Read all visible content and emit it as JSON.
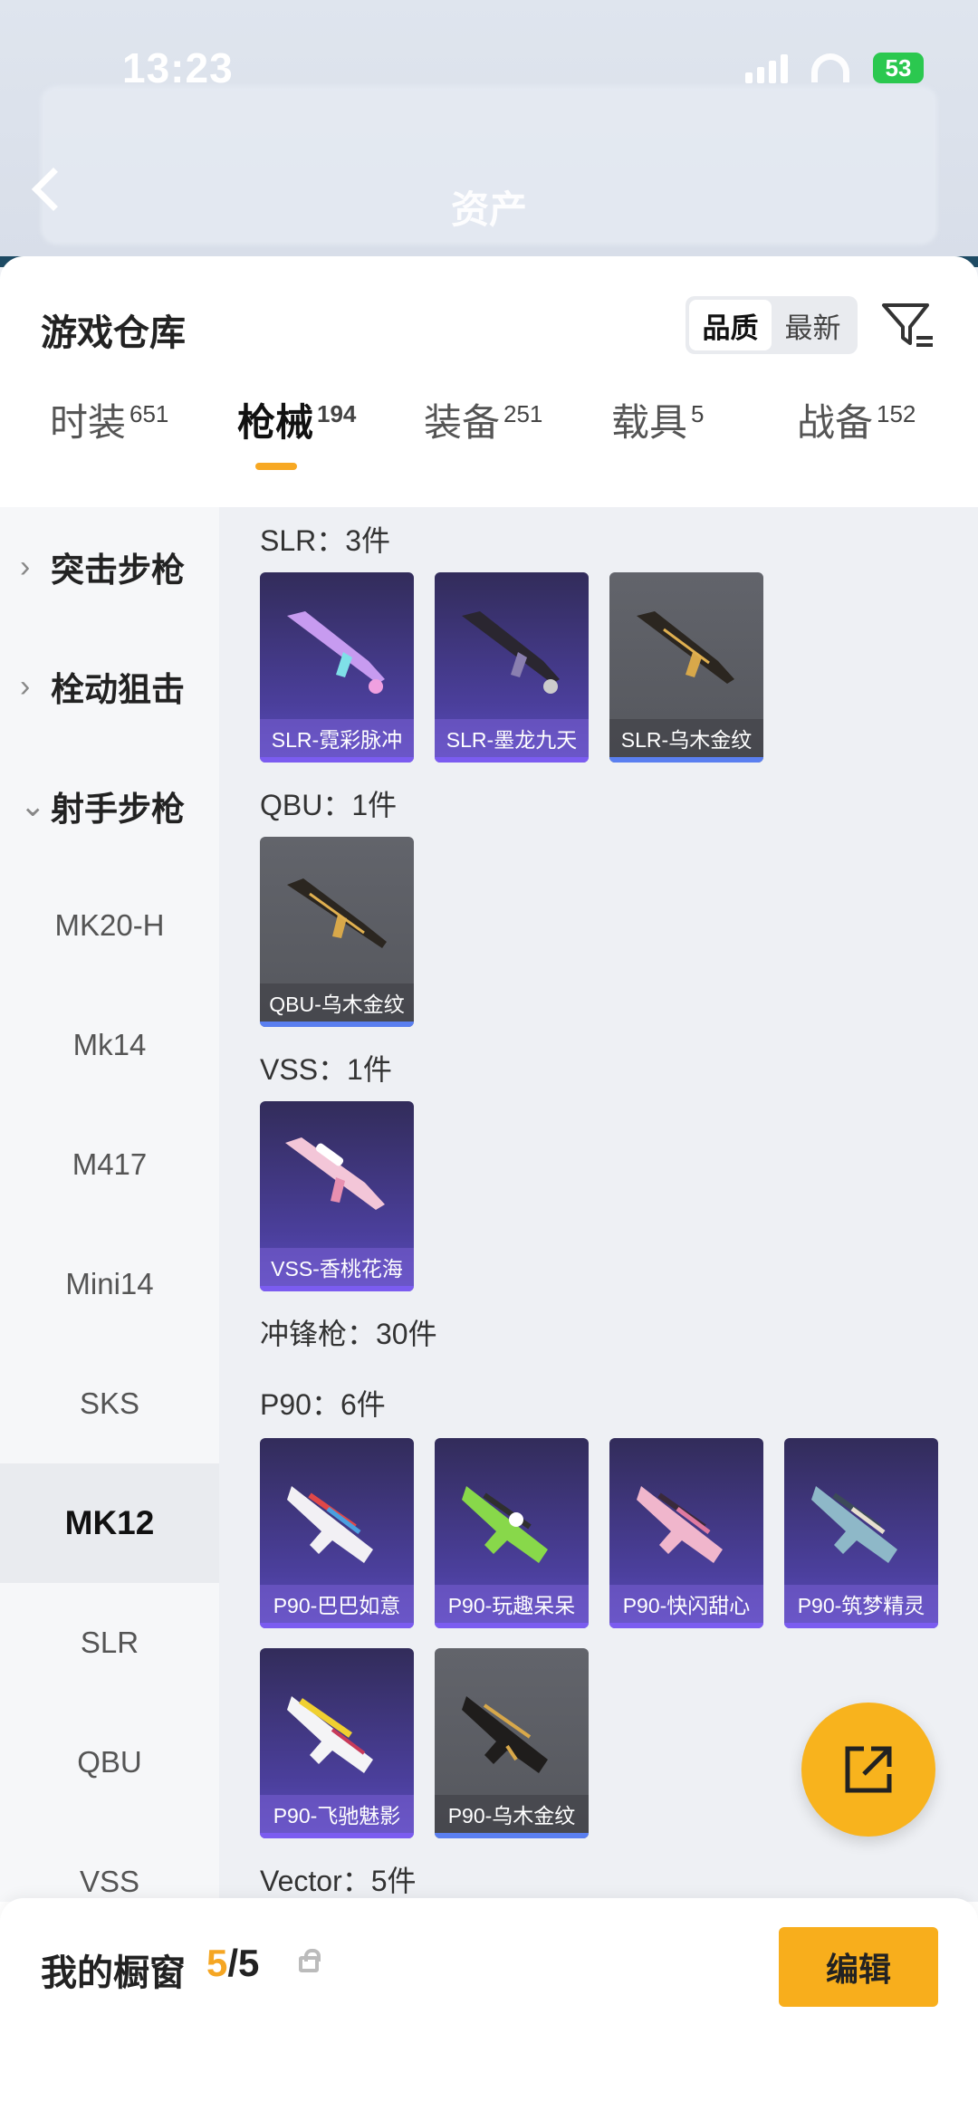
{
  "status": {
    "time": "13:23",
    "battery": "53"
  },
  "header": {
    "title": "资产"
  },
  "warehouse": {
    "title": "游戏仓库",
    "sort_options": [
      "品质",
      "最新"
    ],
    "sort_active": "品质"
  },
  "tabs": [
    {
      "label": "时装",
      "count": "651"
    },
    {
      "label": "枪械",
      "count": "194"
    },
    {
      "label": "装备",
      "count": "251"
    },
    {
      "label": "载具",
      "count": "5"
    },
    {
      "label": "战备",
      "count": "152"
    }
  ],
  "sidebar": {
    "categories": [
      {
        "label": "突击步枪",
        "chev": "›"
      },
      {
        "label": "栓动狙击",
        "chev": "›"
      },
      {
        "label": "射手步枪",
        "chev": "⌄"
      }
    ],
    "subs": [
      "MK20-H",
      "Mk14",
      "M417",
      "Mini14",
      "SKS",
      "MK12",
      "SLR",
      "QBU",
      "VSS"
    ]
  },
  "sections": [
    {
      "title": "SLR：3件",
      "items": [
        "SLR-霓彩脉冲",
        "SLR-墨龙九天",
        "SLR-乌木金纹"
      ]
    },
    {
      "title": "QBU：1件",
      "items": [
        "QBU-乌木金纹"
      ]
    },
    {
      "title": "VSS：1件",
      "items": [
        "VSS-香桃花海"
      ]
    },
    {
      "title": "冲锋枪：30件"
    },
    {
      "title": "P90：6件",
      "items": [
        "P90-巴巴如意",
        "P90-玩趣呆呆",
        "P90-快闪甜心",
        "P90-筑梦精灵",
        "P90-飞驰魅影",
        "P90-乌木金纹"
      ]
    },
    {
      "title": "Vector：5件"
    }
  ],
  "showcase": {
    "title": "我的橱窗",
    "used": "5",
    "total": "/5",
    "edit_label": "编辑"
  },
  "colors": {
    "accent": "#f8ae1c",
    "purple": "#4b3f9c",
    "gray": "#5d5f65"
  }
}
